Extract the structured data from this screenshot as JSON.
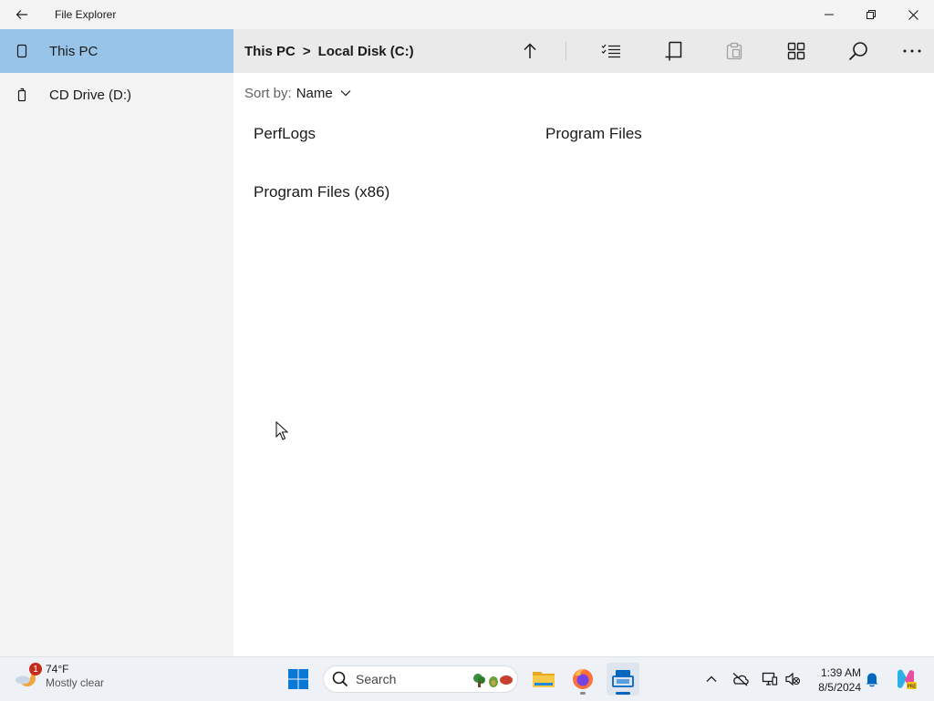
{
  "window": {
    "title": "File Explorer"
  },
  "sidebar": {
    "items": [
      {
        "label": "This PC",
        "icon": "pc-icon",
        "selected": true
      },
      {
        "label": "CD Drive (D:)",
        "icon": "drive-icon",
        "selected": false
      }
    ]
  },
  "breadcrumb": {
    "items": [
      "This PC",
      "Local Disk (C:)"
    ],
    "separator": ">"
  },
  "sort": {
    "label": "Sort by:",
    "value": "Name"
  },
  "files": [
    {
      "name": "PerfLogs"
    },
    {
      "name": "Program Files"
    },
    {
      "name": "Program Files (x86)"
    }
  ],
  "taskbar": {
    "weather": {
      "temp": "74°F",
      "condition": "Mostly clear",
      "badge": "1"
    },
    "search_placeholder": "Search",
    "clock": {
      "time": "1:39 AM",
      "date": "8/5/2024"
    }
  },
  "colors": {
    "selected": "#99c4ea",
    "sidebar_bg": "#f3f3f3",
    "cmdbar_bg": "#eaeaea",
    "accent": "#0067c0"
  }
}
